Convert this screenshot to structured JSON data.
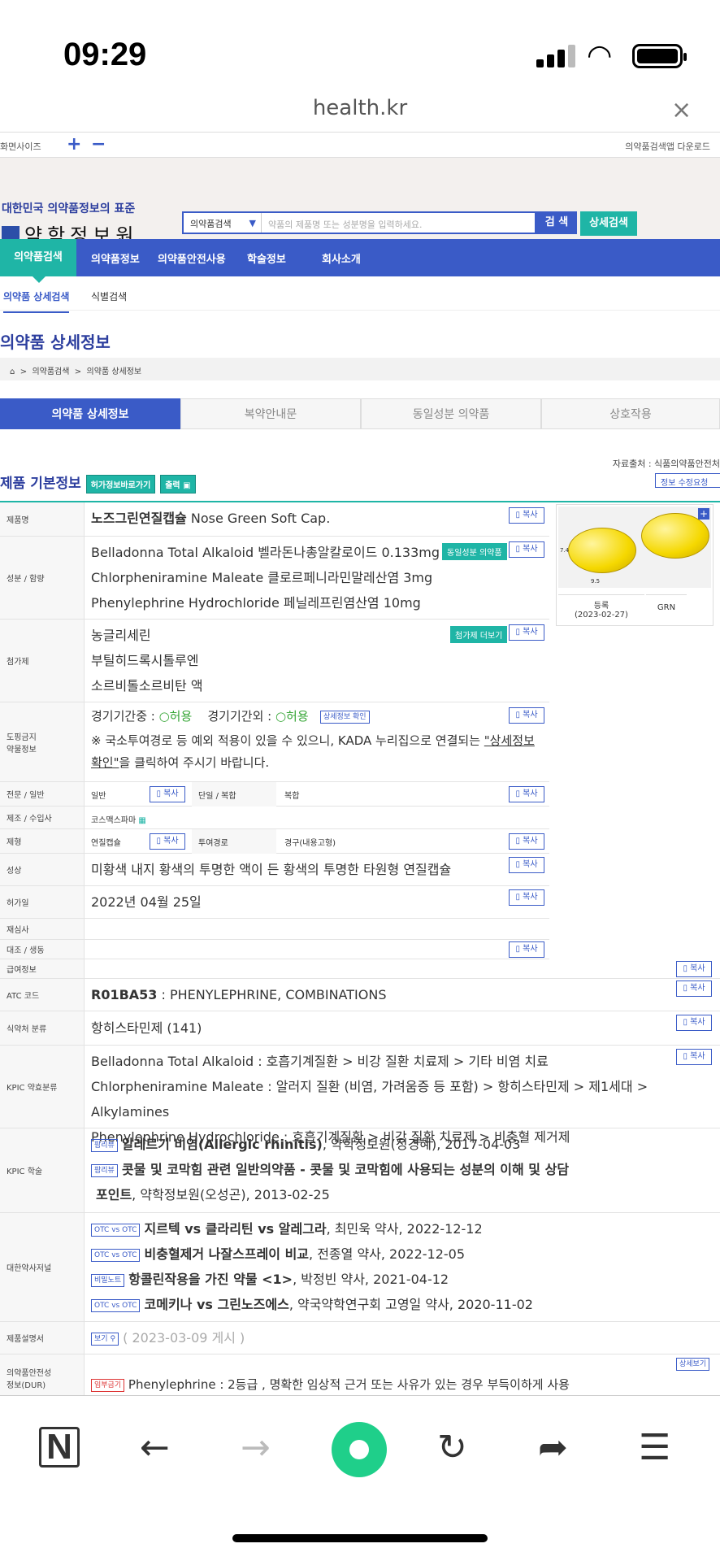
{
  "status": {
    "time": "09:29"
  },
  "browser": {
    "url": "health.kr",
    "close": "×"
  },
  "topbar": {
    "screen_size": "화면사이즈",
    "plus": "+",
    "minus": "−",
    "app_download": "의약품검색앱 다운로드"
  },
  "header": {
    "tagline": "대한민국 의약품정보의 표준",
    "logo": "약학정보원",
    "search_select": "의약품검색",
    "search_placeholder": "약품의 제품명 또는 성분명을 입력하세요.",
    "search_button": "검 색",
    "detail_search": "상세검색"
  },
  "gnb": [
    "의약품검색",
    "의약품정보",
    "의약품안전사용",
    "학술정보",
    "회사소개"
  ],
  "subnav": [
    "의약품 상세검색",
    "식별검색"
  ],
  "page_title": "의약품 상세정보",
  "breadcrumb": [
    "의약품검색",
    "의약품 상세정보"
  ],
  "tabs": [
    "의약품 상세정보",
    "복약안내문",
    "동일성분 의약품",
    "상호작용"
  ],
  "source": "자료출처 : 식품의약품안전처",
  "fix_request": "정보 수정요청",
  "section_title": "제품 기본정보",
  "btn_permit": "허가정보바로가기",
  "btn_print": "출력",
  "copy": "복사",
  "rows": {
    "name": {
      "label": "제품명",
      "bold": "노즈그린연질캡슐",
      "rest": " Nose Green Soft Cap."
    },
    "ingredient": {
      "label": "성분 / 함량",
      "lines": [
        "Belladonna Total Alkaloid   벨라돈나총알칼로이드   0.133mg",
        "Chlorpheniramine Maleate   클로르페니라민말레산염   3mg",
        "Phenylephrine Hydrochloride   페닐레프린염산염   10mg"
      ],
      "same": "동일성분 의약품"
    },
    "additive": {
      "label": "첨가제",
      "lines": [
        "농글리세린",
        "부틸히드록시톨루엔",
        "소르비톨소르비탄 액"
      ],
      "more": "첨가제 더보기"
    },
    "doping": {
      "label1": "도핑금지",
      "label2": "약물정보",
      "in": "경기기간중 : ",
      "in_v": "○허용",
      "out": "경기기간외 : ",
      "out_v": "○허용",
      "detail": "상세정보 확인",
      "note1": "※ 국소투여경로 등 예외 적용이 있을 수 있으니, KADA 누리집으로 연결되는 ",
      "note_link": "\"상세정보",
      "note2": "확인\"",
      "note3": "을 클릭하여 주시기 바랍니다."
    },
    "otc": {
      "label": "전문 / 일반",
      "v": "일반",
      "label2": "단일 / 복합",
      "v2": "복합"
    },
    "maker": {
      "label": "제조 / 수입사",
      "v": "코스맥스파마"
    },
    "form": {
      "label": "제형",
      "v": "연질캡슐",
      "label2": "투여경로",
      "v2": "경구(내용고형)"
    },
    "shape": {
      "label": "성상",
      "v": "미황색 내지 황색의 투명한 액이 든 황색의 투명한 타원형 연질캡슐"
    },
    "date": {
      "label": "허가일",
      "v": "2022년 04월 25일"
    },
    "reexam": {
      "label": "재심사"
    },
    "compare": {
      "label": "대조 / 생동"
    },
    "pay": {
      "label": "급여정보"
    },
    "atc": {
      "label": "ATC 코드",
      "bold": "R01BA53",
      "rest": " : PHENYLEPHRINE, COMBINATIONS"
    },
    "mfds": {
      "label": "식약처 분류",
      "v": "항히스타민제 (141)"
    },
    "kpic": {
      "label": "KPIC 약효분류",
      "lines": [
        "Belladonna Total Alkaloid : 호흡기계질환 > 비강 질환 치료제 > 기타 비염 치료",
        "Chlorpheniramine Maleate : 알러지 질환 (비염, 가려움증 등 포함) > 항히스타민제 > 제1세대 > Alkylamines",
        "Phenylephrine Hydrochloride : 호흡기계질환 > 비강 질환 치료제 > 비충혈 제거제"
      ]
    },
    "academic": {
      "label": "KPIC 학술",
      "items": [
        {
          "tag": "팜리뷰",
          "bold": "알레르기 비염(Allergic rhinitis)",
          "rest": ", 약학정보원(정경혜), 2017-04-03"
        },
        {
          "tag": "팜리뷰",
          "bold": "콧물 및 코막힘 관련 일반의약품 - 콧물 및 코막힘에 사용되는 성분의 이해 및 상담",
          "bold2": "포인트",
          "rest": ", 약학정보원(오성곤), 2013-02-25"
        }
      ]
    },
    "journal": {
      "label": "대한약사저널",
      "items": [
        {
          "tag": "OTC vs OTC",
          "bold": "지르텍 vs 클라리틴 vs 알레그라",
          "rest": ", 최민욱 약사, 2022-12-12"
        },
        {
          "tag": "OTC vs OTC",
          "bold": "비충혈제거 나잘스프레이 비교",
          "rest": ", 전종열 약사, 2022-12-05"
        },
        {
          "tag": "비밀노트",
          "bold": "항콜린작용을 가진 약물 <1>",
          "rest": ", 박정빈 약사, 2021-04-12"
        },
        {
          "tag": "OTC vs OTC",
          "bold": "코메키나 vs 그린노즈에스",
          "rest": ", 약국약학연구회 고영일 약사, 2020-11-02"
        }
      ]
    },
    "manual": {
      "label": "제품설명서",
      "btn": "보기",
      "v": "( 2023-03-09 게시 )"
    },
    "dur": {
      "label1": "의약품안전성",
      "label2": "정보(DUR)",
      "tag": "임부금기",
      "v": " Phenylephrine : 2등급 , 명확한 임상적 근거 또는 사유가 있는 경우 부득이하게 사용",
      "detail": "상세보기"
    }
  },
  "image": {
    "reg": "등록",
    "reg_date": "(2023-02-27)",
    "code": "GRN",
    "dim1": "9.5",
    "dim2": "7.4"
  },
  "bottom_nav": {
    "n": "N",
    "back": "←",
    "fwd": "→",
    "reload": "↻",
    "share": "➦",
    "menu": "☰"
  },
  "colors": {
    "primary": "#3a5bc7",
    "accent": "#1fb5a6",
    "home": "#1fcf8a"
  }
}
